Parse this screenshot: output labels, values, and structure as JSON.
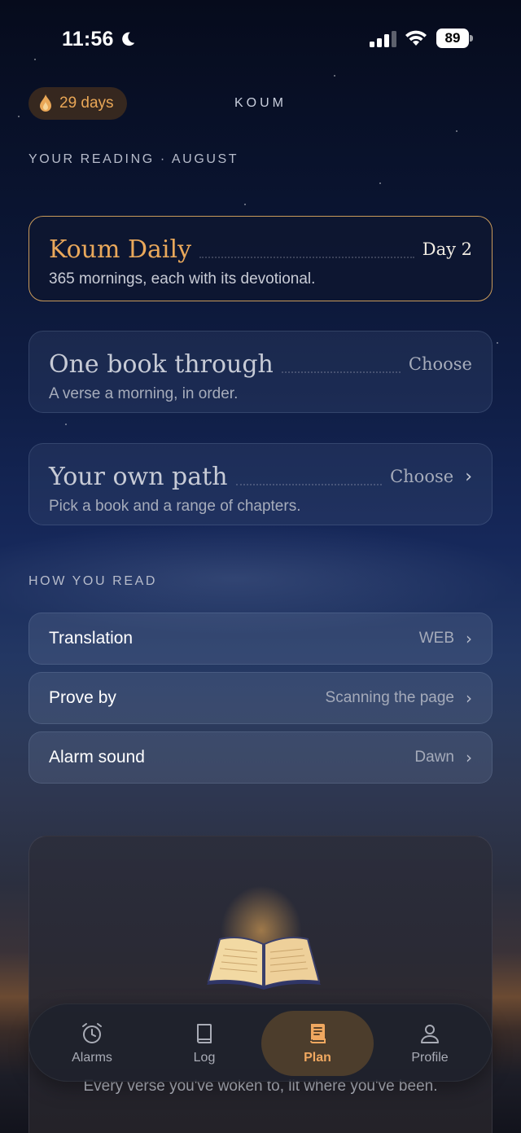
{
  "status_bar": {
    "time": "11:56",
    "battery": "89"
  },
  "header": {
    "streak": "29 days",
    "brand": "KOUM"
  },
  "reading": {
    "section_label": "YOUR READING · AUGUST",
    "plans": [
      {
        "title": "Koum Daily",
        "right": "Day 2",
        "subtitle": "365 mornings, each with its devotional."
      },
      {
        "title": "One book through",
        "right": "Choose",
        "subtitle": "A verse a morning, in order."
      },
      {
        "title": "Your own path",
        "right": "Choose",
        "subtitle": "Pick a book and a range of chapters."
      }
    ]
  },
  "how_you_read": {
    "section_label": "HOW YOU READ",
    "rows": [
      {
        "label": "Translation",
        "value": "WEB"
      },
      {
        "label": "Prove by",
        "value": "Scanning the page"
      },
      {
        "label": "Alarm sound",
        "value": "Dawn"
      }
    ]
  },
  "panel": {
    "caption": "Every verse you've woken to, lit where you've been."
  },
  "tabs": [
    {
      "label": "Alarms",
      "icon": "alarm-clock-icon"
    },
    {
      "label": "Log",
      "icon": "book-icon"
    },
    {
      "label": "Plan",
      "icon": "plan-book-icon",
      "active": true
    },
    {
      "label": "Profile",
      "icon": "person-icon"
    }
  ],
  "colors": {
    "accent": "#e9a85b",
    "background_top": "#060b1c",
    "active_tab": "#f0a860"
  }
}
